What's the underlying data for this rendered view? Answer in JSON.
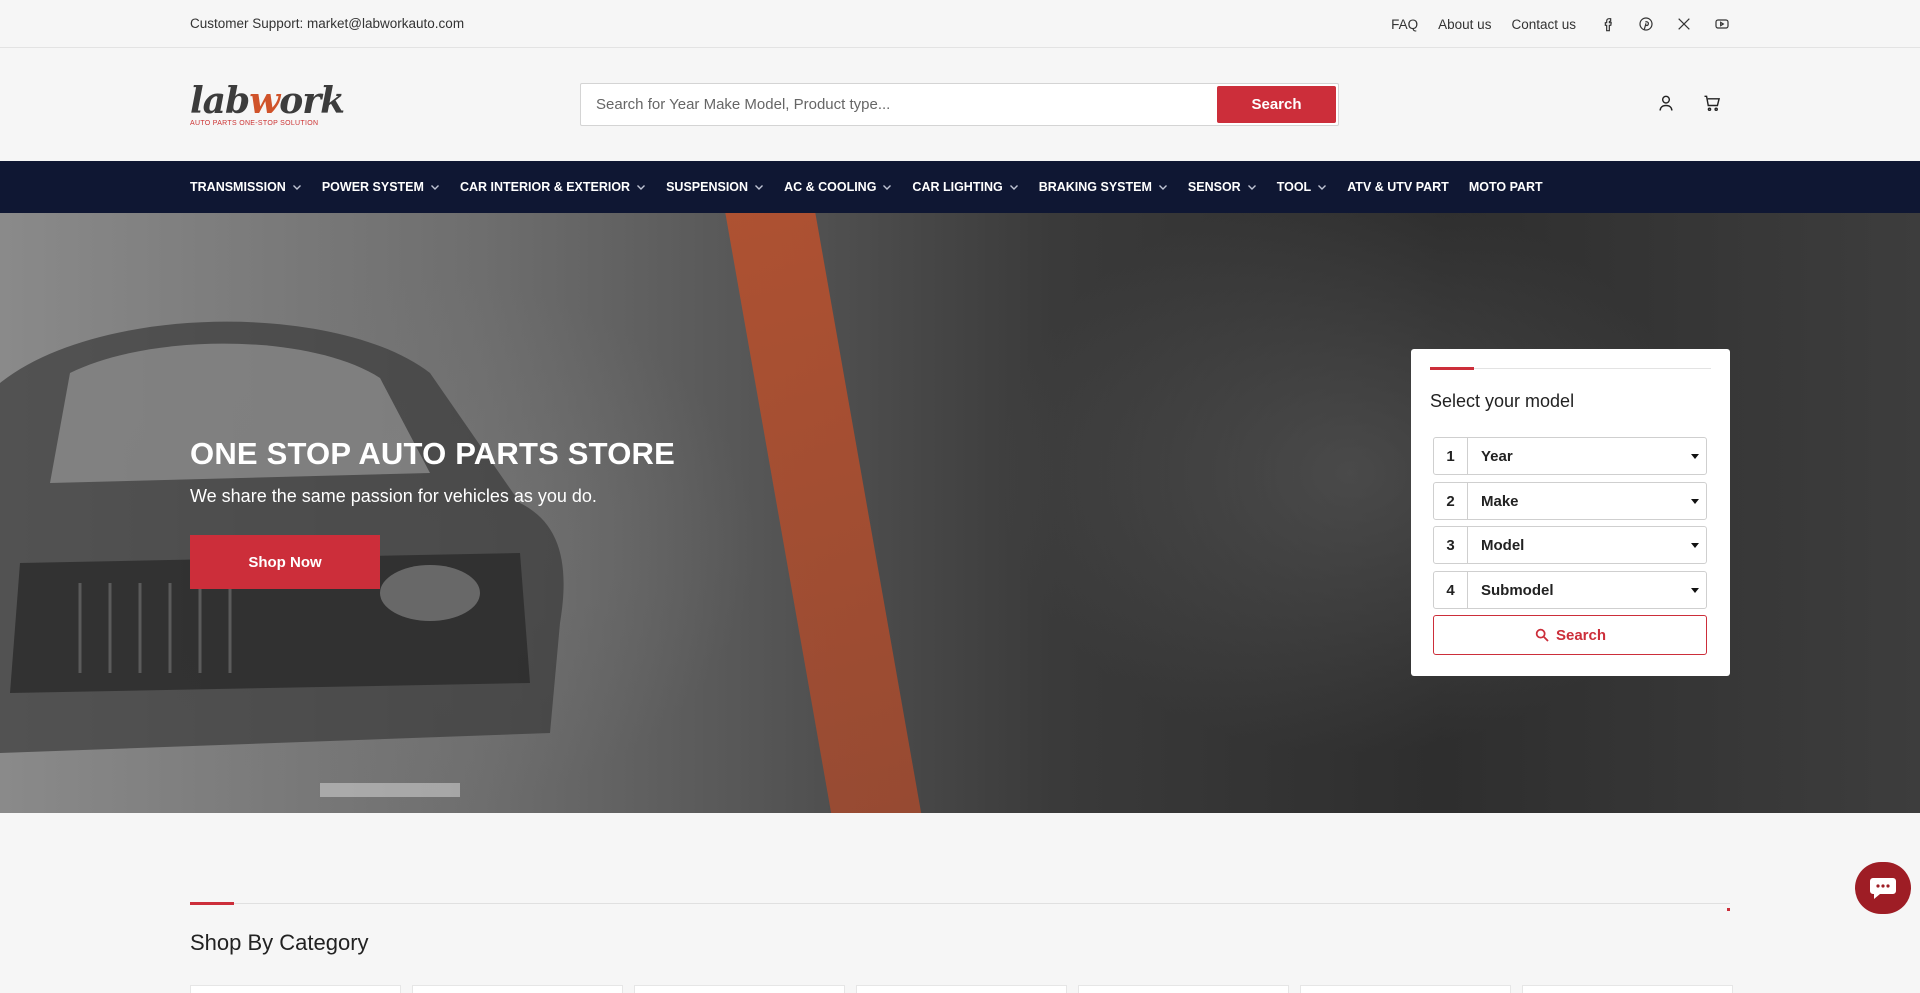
{
  "topbar": {
    "support": "Customer Support: market@labworkauto.com",
    "links": [
      "FAQ",
      "About us",
      "Contact us"
    ],
    "social_icons": [
      "facebook-icon",
      "pinterest-icon",
      "x-icon",
      "youtube-icon"
    ]
  },
  "header": {
    "logo_text": "labwork",
    "logo_tagline": "AUTO PARTS ONE-STOP SOLUTION",
    "search_placeholder": "Search for Year Make Model, Product type...",
    "search_button": "Search",
    "icons": [
      "account-icon",
      "cart-icon"
    ]
  },
  "nav": {
    "items": [
      {
        "label": "TRANSMISSION",
        "dropdown": true
      },
      {
        "label": "POWER SYSTEM",
        "dropdown": true
      },
      {
        "label": "CAR INTERIOR & EXTERIOR",
        "dropdown": true
      },
      {
        "label": "SUSPENSION",
        "dropdown": true
      },
      {
        "label": "AC & COOLING",
        "dropdown": true
      },
      {
        "label": "CAR LIGHTING",
        "dropdown": true
      },
      {
        "label": "BRAKING SYSTEM",
        "dropdown": true
      },
      {
        "label": "SENSOR",
        "dropdown": true
      },
      {
        "label": "TOOL",
        "dropdown": true
      },
      {
        "label": "ATV & UTV PART",
        "dropdown": false
      },
      {
        "label": "MOTO PART",
        "dropdown": false
      }
    ]
  },
  "hero": {
    "title": "ONE STOP AUTO PARTS STORE",
    "subtitle": "We share the same passion for vehicles as you do.",
    "cta": "Shop Now"
  },
  "model_selector": {
    "title": "Select your model",
    "fields": [
      {
        "num": "1",
        "value": "Year"
      },
      {
        "num": "2",
        "value": "Make"
      },
      {
        "num": "3",
        "value": "Model"
      },
      {
        "num": "4",
        "value": "Submodel"
      }
    ],
    "search_button": "Search"
  },
  "category": {
    "title": "Shop By Category"
  },
  "colors": {
    "accent": "#cc2e3a",
    "nav_bg": "#0f1733",
    "chat_bg": "#9e1d25"
  }
}
